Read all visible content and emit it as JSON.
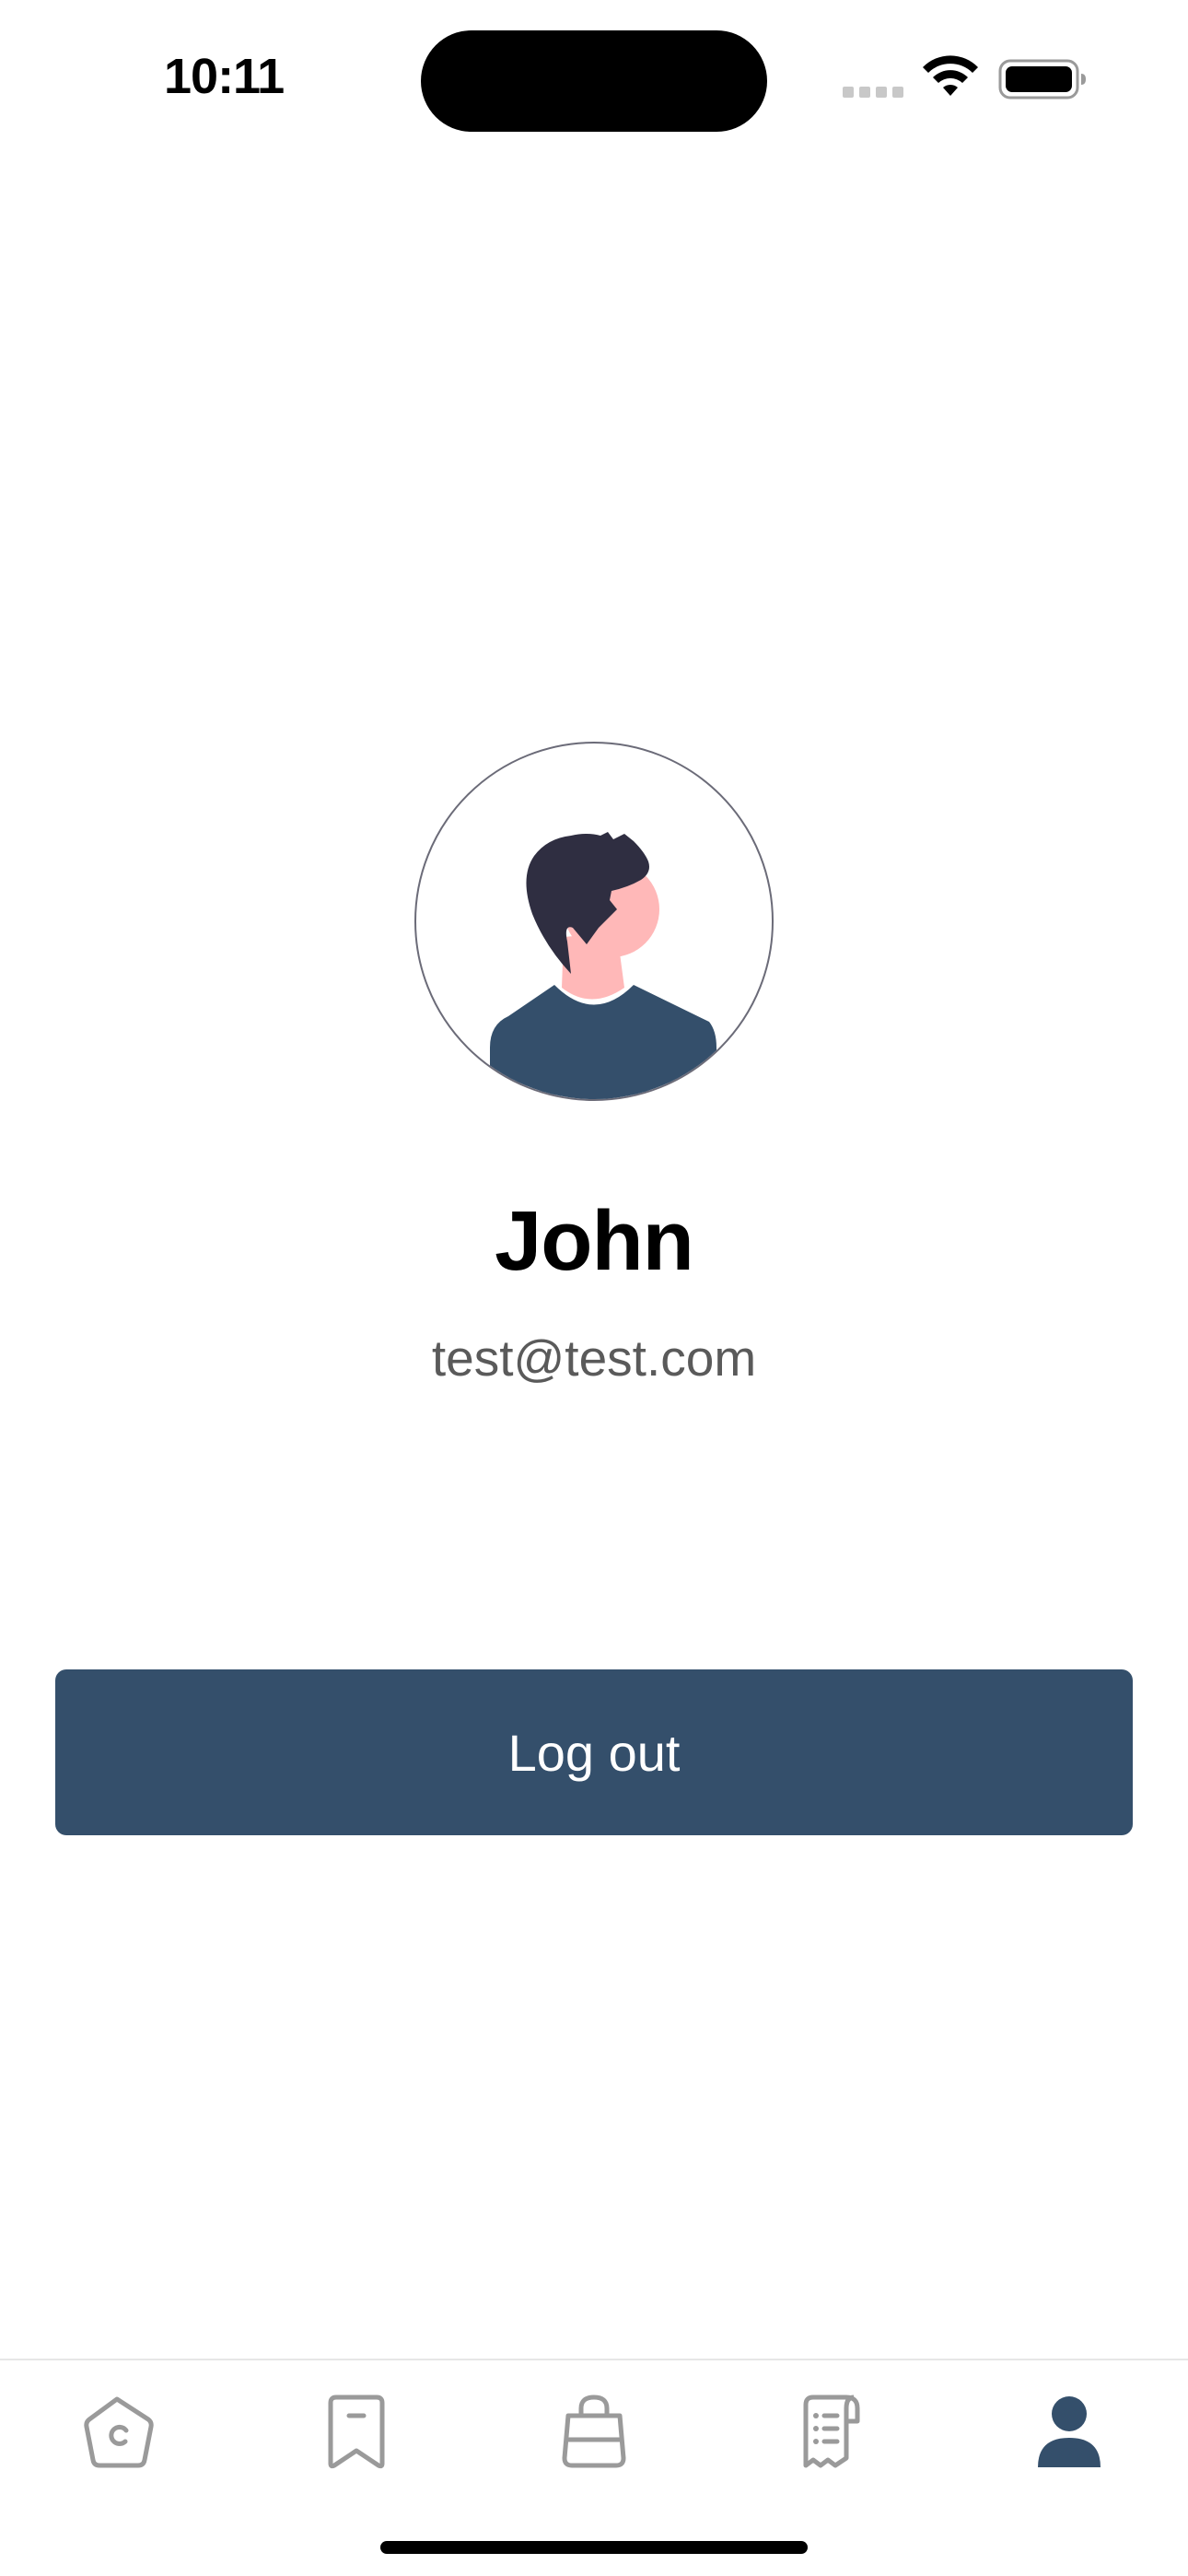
{
  "status_bar": {
    "time": "10:11",
    "icons": [
      "signal-icon",
      "wifi-icon",
      "battery-icon"
    ]
  },
  "profile": {
    "name": "John",
    "email": "test@test.com",
    "avatar_icon": "person-avatar-illustration"
  },
  "actions": {
    "logout_label": "Log out"
  },
  "tab_bar": {
    "tabs": [
      {
        "icon": "home-icon",
        "active": false
      },
      {
        "icon": "bookmark-icon",
        "active": false
      },
      {
        "icon": "shopping-bag-icon",
        "active": false
      },
      {
        "icon": "receipt-icon",
        "active": false
      },
      {
        "icon": "profile-icon",
        "active": true
      }
    ]
  },
  "colors": {
    "accent": "#344f6b",
    "inactive_icon": "#9a9a9a",
    "email_text": "#5a5a5a",
    "hair": "#2f2e41",
    "skin": "#ffb8b8"
  }
}
